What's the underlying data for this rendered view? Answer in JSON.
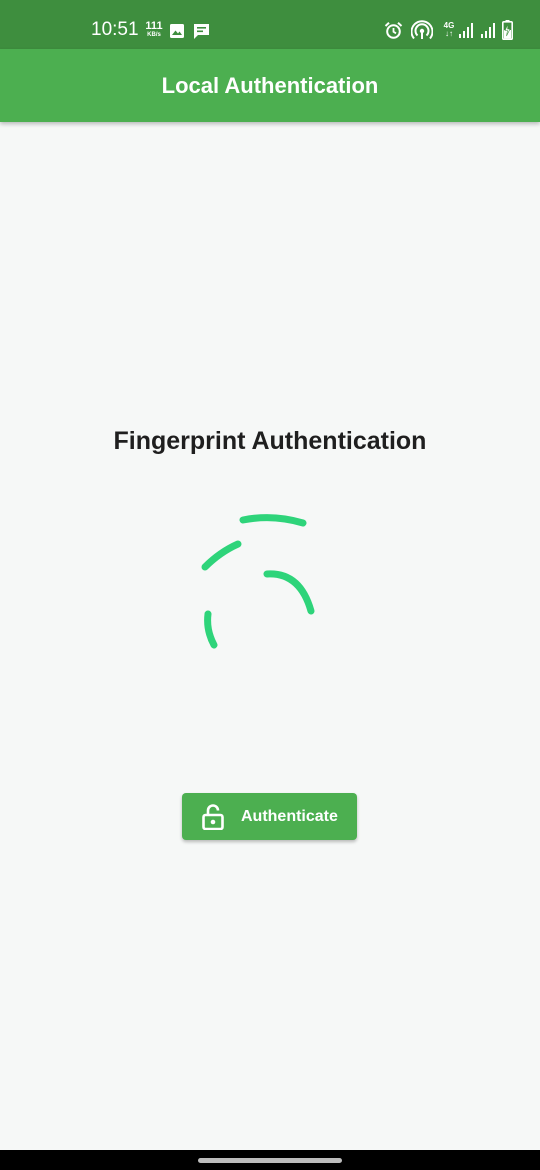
{
  "status_bar": {
    "time": "10:51",
    "net_speed_value": "111",
    "net_speed_unit": "KB/s",
    "network_type": "4G",
    "network_arrows": "↓↑",
    "icons": [
      "image-icon",
      "message-icon",
      "alarm-icon",
      "hotspot-icon",
      "signal-icon",
      "signal-icon",
      "battery-charging-icon"
    ],
    "background": "#3e8e3e"
  },
  "app_bar": {
    "title": "Local Authentication",
    "background": "#4caf50"
  },
  "main": {
    "heading": "Fingerprint Authentication",
    "spinner_color": "#2ed47a",
    "button": {
      "label": "Authenticate",
      "icon": "lock-open-icon",
      "background": "#4caf50"
    }
  },
  "nav_bar": {
    "handle": "gesture-handle"
  }
}
